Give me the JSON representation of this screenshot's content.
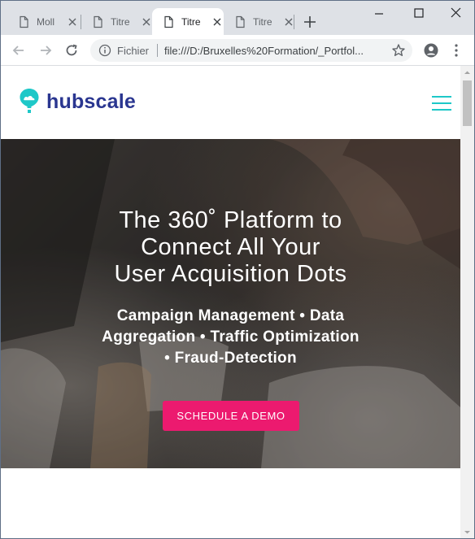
{
  "browser": {
    "tabs": [
      {
        "title": "Moll",
        "active": false
      },
      {
        "title": "Titre",
        "active": false
      },
      {
        "title": "Titre",
        "active": true
      },
      {
        "title": "Titre",
        "active": false
      }
    ],
    "address_bar": {
      "scheme_label": "Fichier",
      "url": "file:///D:/Bruxelles%20Formation/_Portfol..."
    }
  },
  "site": {
    "logo_text": "hubscale",
    "brand_color": "#2a3690",
    "accent_color": "#1ec8c8"
  },
  "hero": {
    "title_lines": [
      "The 360˚ Platform to",
      "Connect All Your",
      "User Acquisition Dots"
    ],
    "subtitle_lines": [
      "Campaign Management • Data",
      "Aggregation • Traffic Optimization",
      "• Fraud-Detection"
    ],
    "cta_label": "SCHEDULE A DEMO",
    "cta_color": "#ec1a6f"
  },
  "icons": [
    "doc-icon",
    "close-icon",
    "plus-icon",
    "minimize-icon",
    "maximize-icon",
    "window-close-icon",
    "back-arrow-icon",
    "forward-arrow-icon",
    "reload-icon",
    "info-icon",
    "star-icon",
    "profile-icon",
    "kebab-menu-icon",
    "hamburger-icon",
    "map-pin-icon"
  ]
}
